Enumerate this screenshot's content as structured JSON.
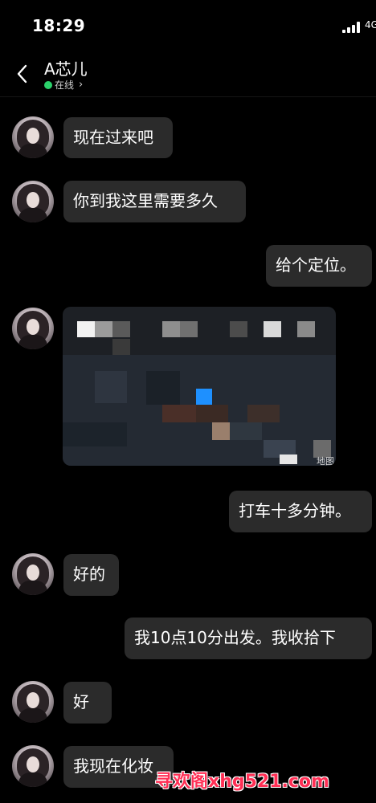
{
  "status_bar": {
    "time": "18:29",
    "network": "4G"
  },
  "header": {
    "title": "A芯儿",
    "presence": "在线"
  },
  "messages": [
    {
      "text": "现在过来吧"
    },
    {
      "text": "你到我这里需要多久"
    },
    {
      "text": "给个定位。"
    },
    {
      "text": "打车十多分钟。"
    },
    {
      "text": "好的"
    },
    {
      "text": "我10点10分出发。我收拾下"
    },
    {
      "text": "好"
    },
    {
      "text": "我现在化妆"
    }
  ],
  "map_card": {
    "label": "地图"
  },
  "watermark": "寻欢阁xhg521.com",
  "colors": {
    "background": "#000000",
    "bubble": "#2b2b2b",
    "online": "#2bd16b",
    "watermark": "#ff2f55"
  }
}
